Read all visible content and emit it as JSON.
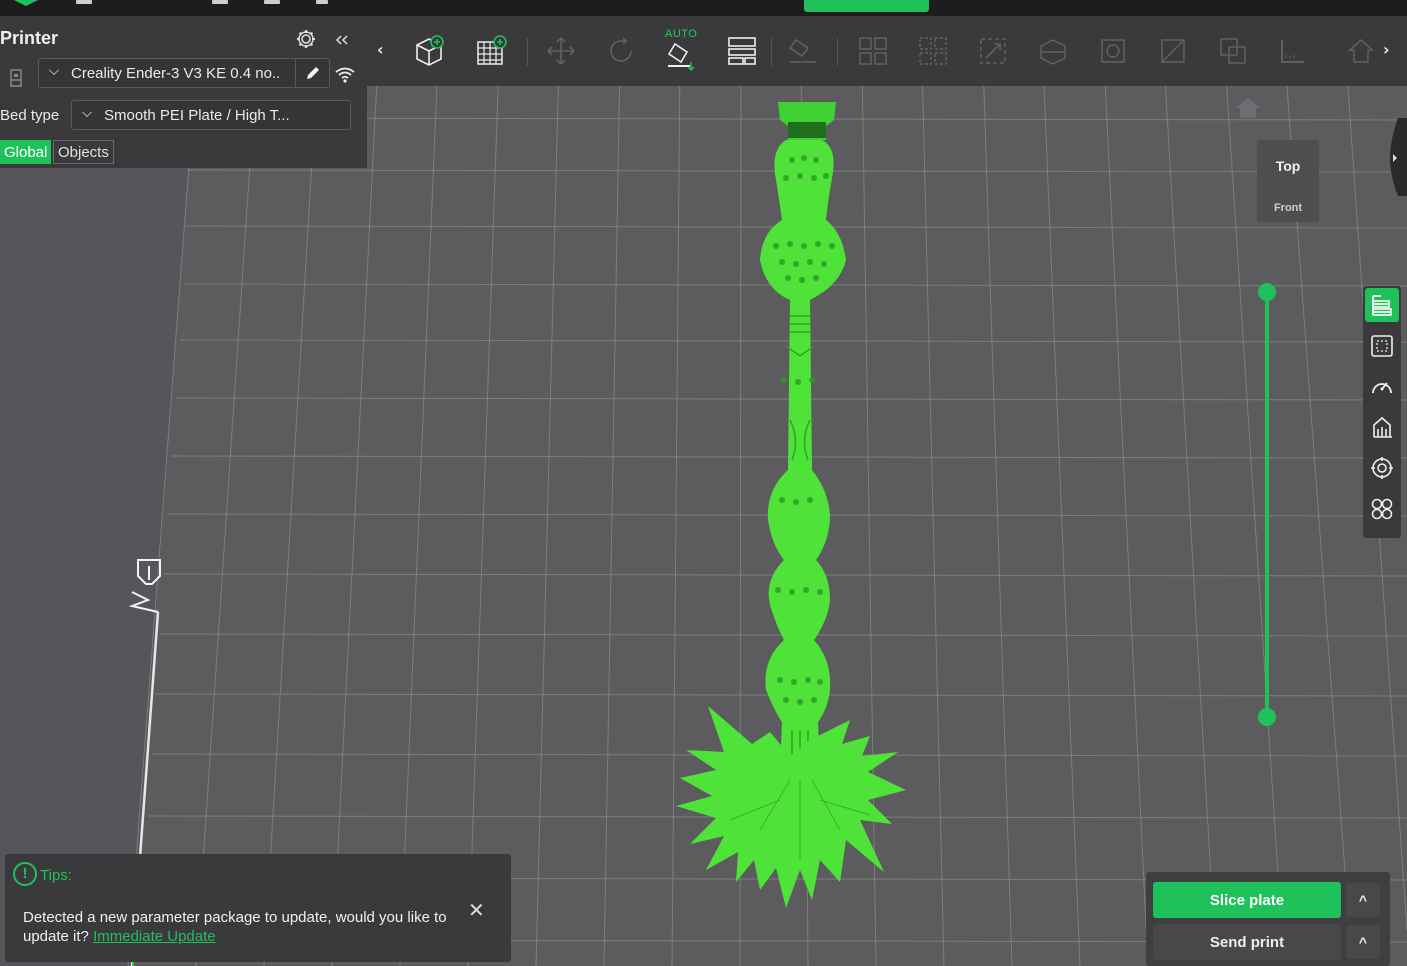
{
  "left_panel": {
    "title": "Printer",
    "printer_name": "Creality Ender-3 V3 KE 0.4 no..",
    "bed_type_label": "Bed type",
    "bed_type_value": "Smooth PEI Plate / High T...",
    "tabs": [
      {
        "label": "Global",
        "active": true
      },
      {
        "label": "Objects",
        "active": false
      }
    ],
    "icons": [
      "printer-icon",
      "gear-icon",
      "collapse-double-chevron-icon",
      "pencil-icon",
      "wifi-icon"
    ]
  },
  "toolbar": {
    "left_arrow": "‹",
    "right_arrow": "›",
    "auto_label": "AUTO",
    "buttons": [
      "add-object-icon",
      "add-plate-icon",
      "move-icon",
      "rotate-icon",
      "auto-orient-icon",
      "arrange-icon",
      "lay-on-face-icon",
      "split-objects-icon",
      "split-parts-icon",
      "scale-icon",
      "cut-icon",
      "support-paint-icon",
      "seam-paint-icon",
      "boolean-icon",
      "measure-icon",
      "assembly-icon"
    ]
  },
  "navcube": {
    "top": "Top",
    "front": "Front"
  },
  "right_tools": {
    "buttons": [
      "layer-view-icon",
      "bounding-box-icon",
      "speed-gauge-icon",
      "support-icon",
      "target-icon",
      "clover-icon"
    ]
  },
  "tips": {
    "title": "Tips:",
    "message": "Detected a new parameter package to update, would you like to update it?",
    "link": "Immediate Update",
    "close": "✕"
  },
  "actions": {
    "slice": "Slice plate",
    "send": "Send print",
    "expand": "^"
  },
  "colors": {
    "accent": "#1fc15a",
    "model": "#4fe33a",
    "panel": "#3a3a3c",
    "bed": "#5a5a5c"
  }
}
